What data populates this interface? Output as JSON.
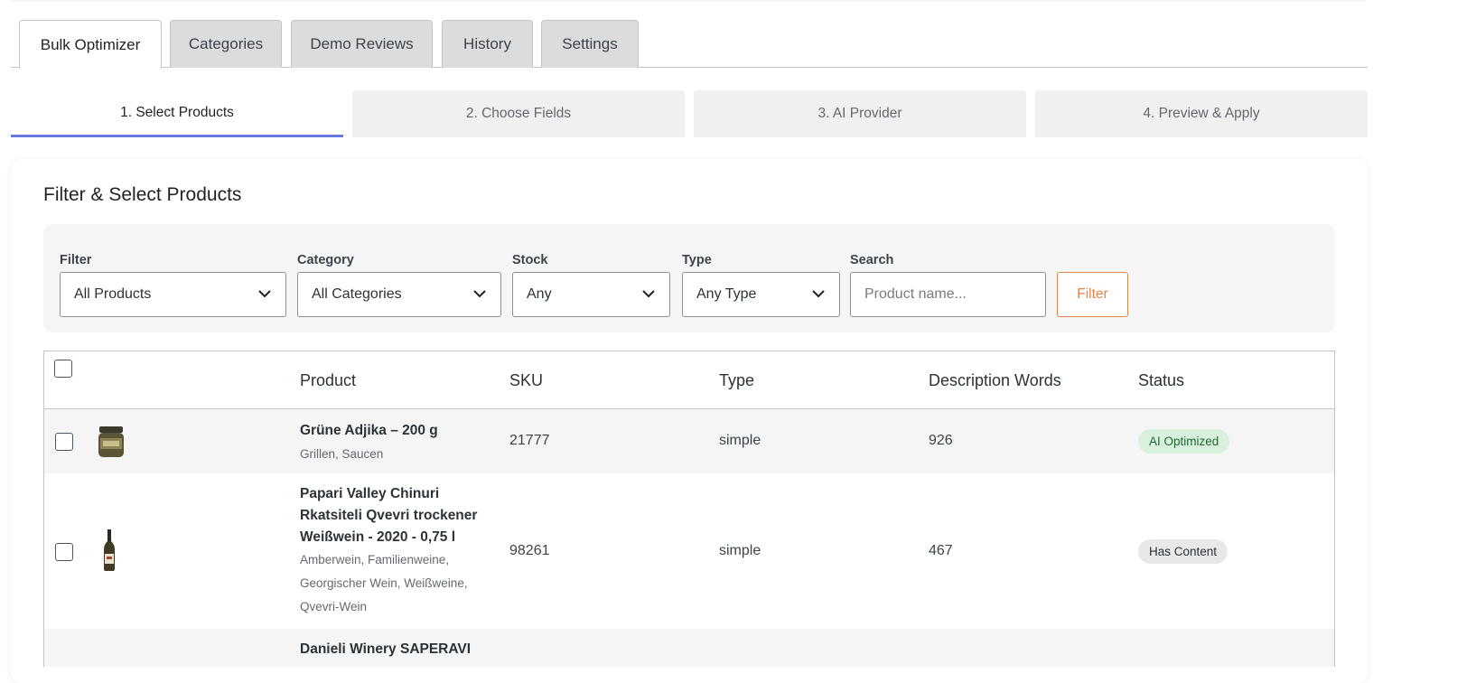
{
  "tabs": [
    {
      "label": "Bulk Optimizer",
      "active": true
    },
    {
      "label": "Categories"
    },
    {
      "label": "Demo Reviews"
    },
    {
      "label": "History"
    },
    {
      "label": "Settings"
    }
  ],
  "steps": [
    {
      "label": "1. Select Products",
      "active": true
    },
    {
      "label": "2. Choose Fields"
    },
    {
      "label": "3. AI Provider"
    },
    {
      "label": "4. Preview & Apply"
    }
  ],
  "card": {
    "title": "Filter & Select Products"
  },
  "filters": {
    "filter": {
      "label": "Filter",
      "value": "All Products"
    },
    "category": {
      "label": "Category",
      "value": "All Categories"
    },
    "stock": {
      "label": "Stock",
      "value": "Any"
    },
    "type": {
      "label": "Type",
      "value": "Any Type"
    },
    "search": {
      "label": "Search",
      "placeholder": "Product name..."
    },
    "button": "Filter"
  },
  "table": {
    "columns": [
      "Product",
      "SKU",
      "Type",
      "Description Words",
      "Status"
    ],
    "rows": [
      {
        "name": "Grüne Adjika – 200 g",
        "categories": "Grillen, Saucen",
        "sku": "21777",
        "type": "simple",
        "words": "926",
        "status": "AI Optimized",
        "thumb": "jar-icon"
      },
      {
        "name_lines": [
          "Papari Valley Chinuri",
          "Rkatsiteli Qvevri trockener",
          "Weißwein - 2020 - 0,75 l"
        ],
        "categories_lines": [
          "Amberwein, Familienweine,",
          "Georgischer Wein, Weißweine,",
          "Qvevri-Wein"
        ],
        "sku": "98261",
        "type": "simple",
        "words": "467",
        "status": "Has Content",
        "thumb": "wine-bottle-icon"
      },
      {
        "name": "Danieli Winery SAPERAVI"
      }
    ]
  },
  "colors": {
    "accent": "#6878e0",
    "filter_button": "#e0854b",
    "status_optimized_bg": "#d9f0de",
    "status_optimized_text": "#1e6b32",
    "status_content_bg": "#e7e8ea"
  }
}
